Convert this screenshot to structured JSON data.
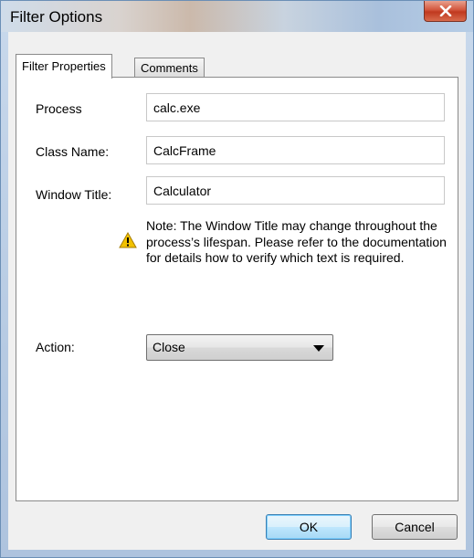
{
  "window": {
    "title": "Filter Options",
    "close_label": "X"
  },
  "tabs": [
    {
      "label": "Filter Properties",
      "active": true
    },
    {
      "label": "Comments",
      "active": false
    }
  ],
  "form": {
    "process_label": "Process",
    "process_value": "calc.exe",
    "class_label": "Class Name:",
    "class_value": "CalcFrame",
    "title_label": "Window Title:",
    "title_value": "Calculator",
    "note": "Note: The Window Title  may change throughout the process’s lifespan. Please refer to the documentation for details how to verify which text is required.",
    "note_icon": "warning-icon",
    "action_label": "Action:",
    "action_value": "Close"
  },
  "buttons": {
    "ok": "OK",
    "cancel": "Cancel"
  },
  "colors": {
    "close_button": "#c7432a",
    "default_button_border": "#3c7fb1"
  }
}
